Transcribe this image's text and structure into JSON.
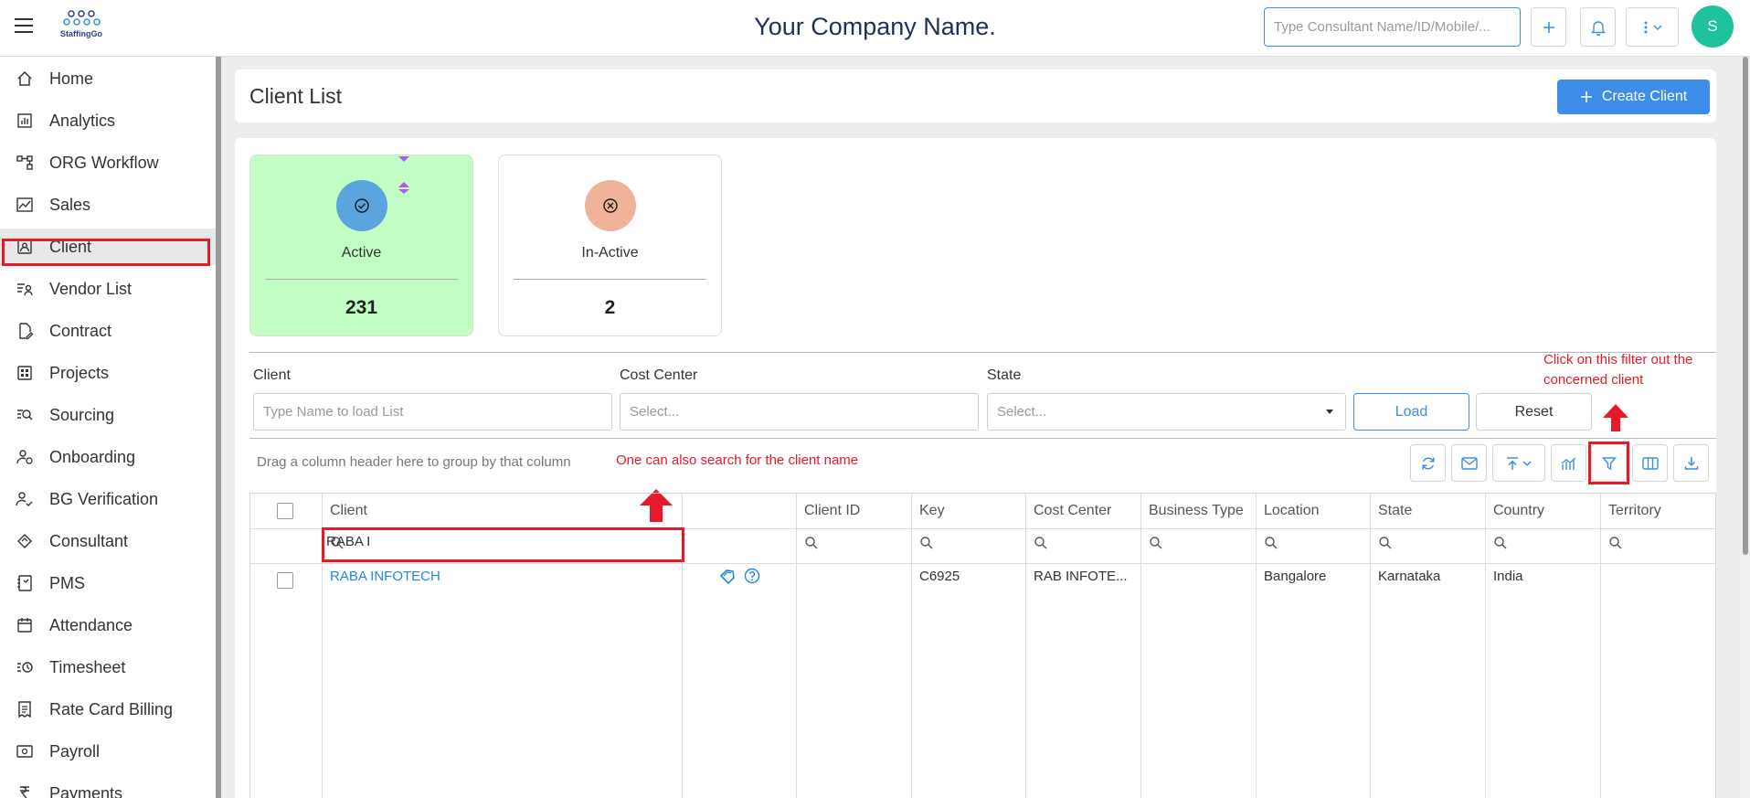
{
  "topbar": {
    "logo_text": "StaffingGo",
    "company_name": "Your Company Name.",
    "search_placeholder": "Type Consultant Name/ID/Mobile/...",
    "avatar_initial": "S"
  },
  "sidebar": {
    "items": [
      {
        "label": "Home",
        "icon": "home-icon"
      },
      {
        "label": "Analytics",
        "icon": "analytics-icon"
      },
      {
        "label": "ORG Workflow",
        "icon": "workflow-icon"
      },
      {
        "label": "Sales",
        "icon": "sales-icon"
      },
      {
        "label": "Client",
        "icon": "client-icon"
      },
      {
        "label": "Vendor List",
        "icon": "vendor-icon"
      },
      {
        "label": "Contract",
        "icon": "contract-icon"
      },
      {
        "label": "Projects",
        "icon": "projects-icon"
      },
      {
        "label": "Sourcing",
        "icon": "sourcing-icon"
      },
      {
        "label": "Onboarding",
        "icon": "onboarding-icon"
      },
      {
        "label": "BG Verification",
        "icon": "verification-icon"
      },
      {
        "label": "Consultant",
        "icon": "consultant-icon"
      },
      {
        "label": "PMS",
        "icon": "pms-icon"
      },
      {
        "label": "Attendance",
        "icon": "calendar-icon"
      },
      {
        "label": "Timesheet",
        "icon": "timesheet-icon"
      },
      {
        "label": "Rate Card Billing",
        "icon": "billing-icon"
      },
      {
        "label": "Payroll",
        "icon": "payroll-icon"
      },
      {
        "label": "Payments",
        "icon": "payments-icon"
      }
    ],
    "selected": "Client"
  },
  "page": {
    "title": "Client List",
    "create_label": "Create Client"
  },
  "status": {
    "active_label": "Active",
    "active_count": "231",
    "inactive_label": "In-Active",
    "inactive_count": "2"
  },
  "filters": {
    "client_label": "Client",
    "client_placeholder": "Type Name to load List",
    "cost_center_label": "Cost Center",
    "cost_center_placeholder": "Select...",
    "state_label": "State",
    "state_placeholder": "Select...",
    "load_label": "Load",
    "reset_label": "Reset"
  },
  "annotations": {
    "filter_note": "Click on this filter out the concerned client",
    "search_note": "One can also search for the client name"
  },
  "grid": {
    "group_hint": "Drag a column header here to group by that column",
    "columns": [
      "Client",
      "Client ID",
      "Key",
      "Cost Center",
      "Business Type",
      "Location",
      "State",
      "Country",
      "Territory"
    ],
    "client_filter_value": "RABA I",
    "rows": [
      {
        "client": "RABA INFOTECH",
        "client_id": "",
        "key": "C6925",
        "cost_center": "RAB INFOTE...",
        "business_type": "",
        "location": "Bangalore",
        "state": "Karnataka",
        "country": "India",
        "territory": ""
      }
    ]
  },
  "colors": {
    "accent": "#3d8ee8",
    "active_card": "#c2fec3",
    "active_circle": "#5ba4dd",
    "inactive_circle": "#f0b39a",
    "annotation": "#e51a2a",
    "avatar": "#1fc29d"
  }
}
